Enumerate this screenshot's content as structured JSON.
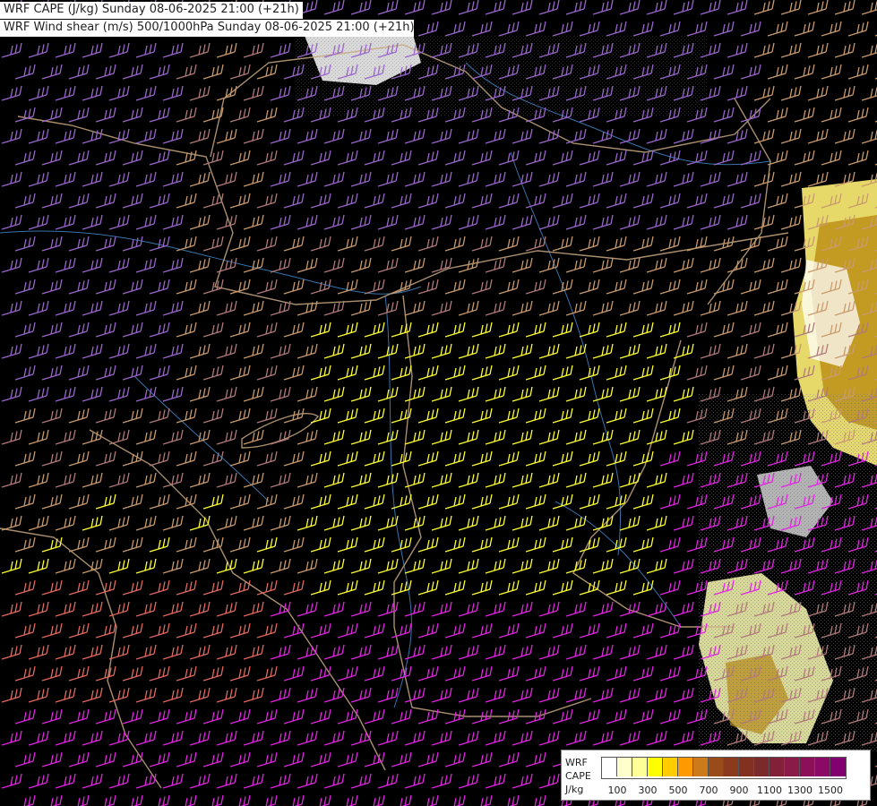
{
  "titles": {
    "line1": "WRF CAPE (J/kg) Sunday 08-06-2025 21:00 (+21h)",
    "line2": "WRF Wind shear (m/s) 500/1000hPa Sunday 08-06-2025 21:00 (+21h)"
  },
  "legend": {
    "model": "WRF",
    "field": "CAPE",
    "unit": "J/kg",
    "colors": [
      "#ffffff",
      "#ffffcc",
      "#ffff99",
      "#ffff00",
      "#ffcc00",
      "#ff9900",
      "#cc7a1a",
      "#994c1a",
      "#8c3a1e",
      "#82301f",
      "#7a2a2a",
      "#822038",
      "#8a1a48",
      "#8c1058",
      "#8a0a66",
      "#820070"
    ],
    "ticks": [
      "100",
      "300",
      "500",
      "700",
      "900",
      "1100",
      "1300",
      "1500"
    ]
  },
  "shear_colors": {
    "lavender": "#9966cc",
    "tan": "#c89a6e",
    "dusty_rose": "#b07a7a",
    "yellow": "#ffff33",
    "salmon": "#e06a60",
    "magenta": "#e026e0"
  },
  "map_colors": {
    "background": "#000000",
    "borders": "#c8a882",
    "rivers": "#3e7fbf"
  }
}
